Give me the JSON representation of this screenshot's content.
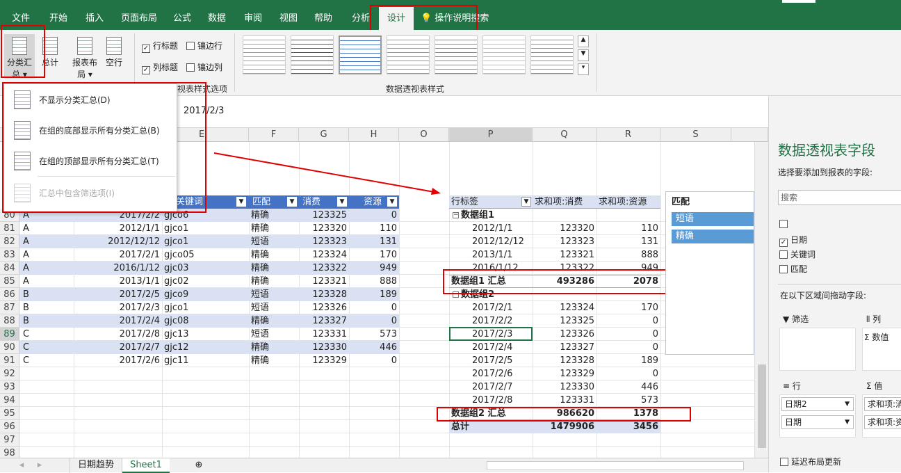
{
  "ribbon_tabs": [
    "文件",
    "开始",
    "插入",
    "页面布局",
    "公式",
    "数据",
    "审阅",
    "视图",
    "帮助",
    "分析",
    "设计"
  ],
  "tell_me": "操作说明搜索",
  "ribbon": {
    "subtotal_line1": "分类汇",
    "subtotal_line2": "总",
    "total": "总计",
    "report_layout_1": "报表布",
    "report_layout_2": "局",
    "blank_rows": "空行",
    "row_headers": "行标题",
    "banded_rows": "镶边行",
    "col_headers": "列标题",
    "banded_cols": "镶边列",
    "style_options_label": "视表样式选项",
    "styles_label": "数据透视表样式"
  },
  "formula_value": "2017/2/3",
  "menu": [
    {
      "label": "不显示分类汇总(D)",
      "enabled": true
    },
    {
      "label": "在组的底部显示所有分类汇总(B)",
      "enabled": true
    },
    {
      "label": "在组的顶部显示所有分类汇总(T)",
      "enabled": true
    },
    {
      "label": "汇总中包含筛选项(I)",
      "enabled": false
    }
  ],
  "col_headers": [
    "E",
    "F",
    "G",
    "H",
    "O",
    "P",
    "Q",
    "R",
    "S"
  ],
  "table_headers": {
    "keyword": "关键词",
    "match": "匹配",
    "cost": "消费",
    "resource": "资源"
  },
  "rows": [
    {
      "n": "80",
      "a": "A",
      "date": "2017/2/2",
      "kw": "gjco6",
      "match": "精确",
      "cost": "123325",
      "res": "0"
    },
    {
      "n": "81",
      "a": "A",
      "date": "2012/1/1",
      "kw": "gjco1",
      "match": "精确",
      "cost": "123320",
      "res": "110"
    },
    {
      "n": "82",
      "a": "A",
      "date": "2012/12/12",
      "kw": "gjco1",
      "match": "短语",
      "cost": "123323",
      "res": "131"
    },
    {
      "n": "83",
      "a": "A",
      "date": "2017/2/1",
      "kw": "gjco05",
      "match": "精确",
      "cost": "123324",
      "res": "170"
    },
    {
      "n": "84",
      "a": "A",
      "date": "2016/1/12",
      "kw": "gjc03",
      "match": "精确",
      "cost": "123322",
      "res": "949"
    },
    {
      "n": "85",
      "a": "A",
      "date": "2013/1/1",
      "kw": "gjc02",
      "match": "精确",
      "cost": "123321",
      "res": "888"
    },
    {
      "n": "86",
      "a": "B",
      "date": "2017/2/5",
      "kw": "gjco9",
      "match": "短语",
      "cost": "123328",
      "res": "189"
    },
    {
      "n": "87",
      "a": "B",
      "date": "2017/2/3",
      "kw": "gjco1",
      "match": "短语",
      "cost": "123326",
      "res": "0"
    },
    {
      "n": "88",
      "a": "B",
      "date": "2017/2/4",
      "kw": "gjc08",
      "match": "精确",
      "cost": "123327",
      "res": "0"
    },
    {
      "n": "89",
      "a": "C",
      "date": "2017/2/8",
      "kw": "gjc13",
      "match": "短语",
      "cost": "123331",
      "res": "573"
    },
    {
      "n": "90",
      "a": "C",
      "date": "2017/2/7",
      "kw": "gjc12",
      "match": "精确",
      "cost": "123330",
      "res": "446"
    },
    {
      "n": "91",
      "a": "C",
      "date": "2017/2/6",
      "kw": "gjc11",
      "match": "精确",
      "cost": "123329",
      "res": "0"
    },
    {
      "n": "92"
    },
    {
      "n": "93"
    },
    {
      "n": "94"
    },
    {
      "n": "95"
    },
    {
      "n": "96"
    },
    {
      "n": "97"
    },
    {
      "n": "98"
    }
  ],
  "pivot": {
    "h_row": "行标签",
    "h_cost": "求和项:消费",
    "h_res": "求和项:资源",
    "rows": [
      {
        "label": "数据组1",
        "type": "group"
      },
      {
        "label": "2012/1/1",
        "cost": "123320",
        "res": "110",
        "type": "item"
      },
      {
        "label": "2012/12/12",
        "cost": "123323",
        "res": "131",
        "type": "item"
      },
      {
        "label": "2013/1/1",
        "cost": "123321",
        "res": "888",
        "type": "item"
      },
      {
        "label": "2016/1/12",
        "cost": "123322",
        "res": "949",
        "type": "item"
      },
      {
        "label": "数据组1 汇总",
        "cost": "493286",
        "res": "2078",
        "type": "sub"
      },
      {
        "label": "数据组2",
        "type": "group"
      },
      {
        "label": "2017/2/1",
        "cost": "123324",
        "res": "170",
        "type": "item"
      },
      {
        "label": "2017/2/2",
        "cost": "123325",
        "res": "0",
        "type": "item"
      },
      {
        "label": "2017/2/3",
        "cost": "123326",
        "res": "0",
        "type": "item"
      },
      {
        "label": "2017/2/4",
        "cost": "123327",
        "res": "0",
        "type": "item"
      },
      {
        "label": "2017/2/5",
        "cost": "123328",
        "res": "189",
        "type": "item"
      },
      {
        "label": "2017/2/6",
        "cost": "123329",
        "res": "0",
        "type": "item"
      },
      {
        "label": "2017/2/7",
        "cost": "123330",
        "res": "446",
        "type": "item"
      },
      {
        "label": "2017/2/8",
        "cost": "123331",
        "res": "573",
        "type": "item"
      },
      {
        "label": "数据组2 汇总",
        "cost": "986620",
        "res": "1378",
        "type": "sub"
      },
      {
        "label": "总计",
        "cost": "1479906",
        "res": "3456",
        "type": "total"
      }
    ]
  },
  "slicer": {
    "title": "匹配",
    "items": [
      "短语",
      "精确"
    ]
  },
  "pane": {
    "title": "数据透视表字段",
    "subtitle": "选择要添加到报表的字段:",
    "search": "搜索",
    "fields": [
      {
        "label": "",
        "checked": false
      },
      {
        "label": "日期",
        "checked": true
      },
      {
        "label": "关键词",
        "checked": false
      },
      {
        "label": "匹配",
        "checked": false
      }
    ],
    "drag_label": "在以下区域间拖动字段:",
    "filter": "筛选",
    "columns": "列",
    "rows": "行",
    "values": "值",
    "col_item": "数值",
    "row_items": [
      "日期2",
      "日期"
    ],
    "val_items": [
      "求和项:消",
      "求和项:资"
    ],
    "defer": "延迟布局更新"
  },
  "sheet_tabs": [
    "日期趋势",
    "Sheet1"
  ]
}
